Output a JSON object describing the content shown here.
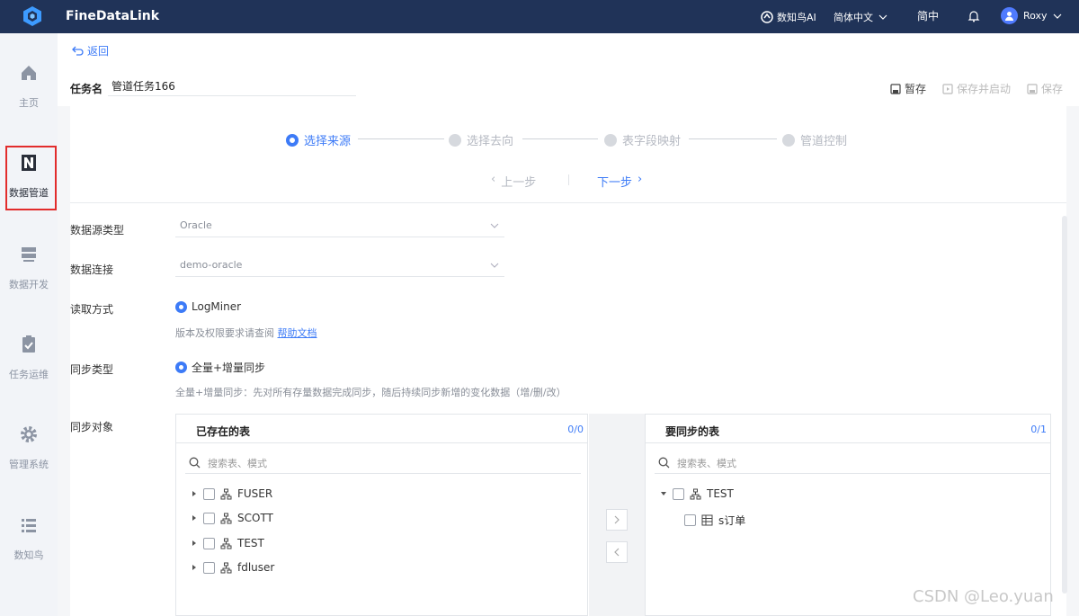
{
  "topbar": {
    "app_title": "FineDataLink",
    "ai_label": "数知鸟AI",
    "language": "简体中文",
    "lang_short": "简中",
    "user_name": "Roxy"
  },
  "sidebar": {
    "items": [
      {
        "label": "主页",
        "icon": "home-icon"
      },
      {
        "label": "数据管道",
        "icon": "pipeline-icon",
        "active": true
      },
      {
        "label": "数据开发",
        "icon": "server-icon"
      },
      {
        "label": "任务运维",
        "icon": "clipboard-check-icon"
      },
      {
        "label": "管理系统",
        "icon": "gear-icon"
      },
      {
        "label": "数知鸟",
        "icon": "list-icon"
      }
    ]
  },
  "header": {
    "back_label": "返回",
    "task_name_label": "任务名",
    "task_name_value": "管道任务166",
    "actions": {
      "save_draft": "暂存",
      "save_and_start": "保存并启动",
      "save": "保存"
    }
  },
  "steps": [
    {
      "label": "选择来源",
      "active": true
    },
    {
      "label": "选择去向",
      "active": false
    },
    {
      "label": "表字段映射",
      "active": false
    },
    {
      "label": "管道控制",
      "active": false
    }
  ],
  "nav": {
    "prev": "上一步",
    "next": "下一步"
  },
  "form": {
    "source_type": {
      "label": "数据源类型",
      "value": "Oracle"
    },
    "connection": {
      "label": "数据连接",
      "value": "demo-oracle"
    },
    "read_mode": {
      "label": "读取方式",
      "option": "LogMiner",
      "hint": "版本及权限要求请查阅",
      "help_link": "帮助文档"
    },
    "sync_type": {
      "label": "同步类型",
      "option": "全量+增量同步",
      "hint": "全量+增量同步：先对所有存量数据完成同步，随后持续同步新增的变化数据（增/删/改）"
    },
    "sync_object": {
      "label": "同步对象"
    }
  },
  "transfer": {
    "left": {
      "title": "已存在的表",
      "count": "0/0",
      "search_placeholder": "搜索表、模式",
      "items": [
        "FUSER",
        "SCOTT",
        "TEST",
        "fdluser"
      ]
    },
    "right": {
      "title": "要同步的表",
      "count": "0/1",
      "search_placeholder": "搜索表、模式",
      "schema": "TEST",
      "table": "s订单"
    }
  },
  "watermark": "CSDN @Leo.yuan",
  "colors": {
    "accent": "#3d7bf7",
    "topbar": "#203358",
    "highlight": "#e22c2c"
  }
}
